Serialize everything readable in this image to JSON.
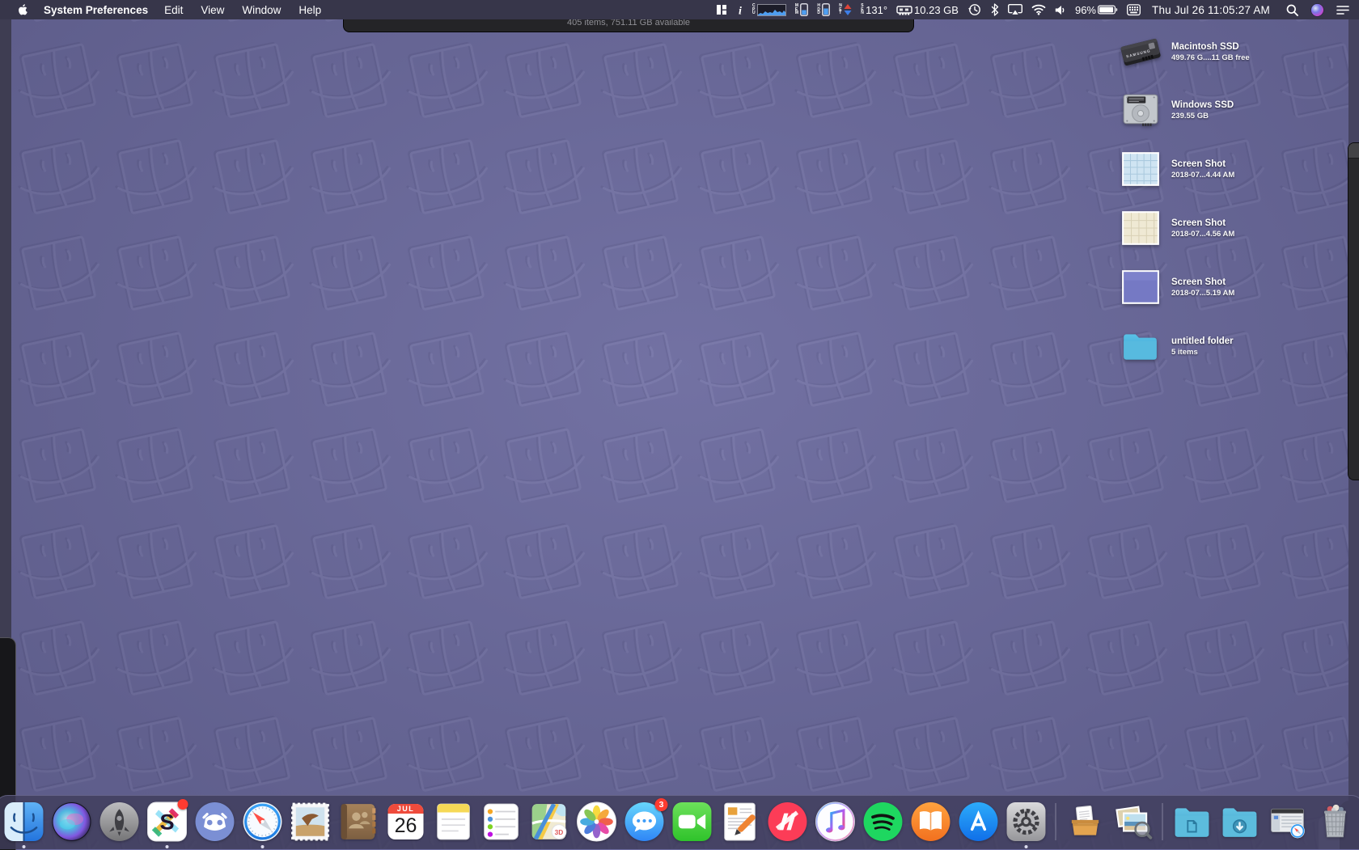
{
  "menu_bar": {
    "app_name": "System Preferences",
    "menus": [
      "Edit",
      "View",
      "Window",
      "Help"
    ],
    "status": {
      "istat_cpu_label": "CPU",
      "istat_mem_label": "MEM",
      "istat_hdd_label": "HDD",
      "istat_net_label": "NET",
      "istat_sen_label": "SEN",
      "sensor_temp": "131°",
      "memory_value": "10.23 GB",
      "battery_percent": "96%",
      "clock": "Thu Jul 26  11:05:27 AM"
    }
  },
  "finder_window": {
    "status_text": "405 items, 751.11 GB available"
  },
  "desktop": {
    "items": [
      {
        "id": "macintosh-ssd",
        "icon": "ssd",
        "name": "Macintosh SSD",
        "info": "499.76 G....11 GB free"
      },
      {
        "id": "windows-ssd",
        "icon": "hdd",
        "name": "Windows SSD",
        "info": "239.55 GB"
      },
      {
        "id": "screenshot-1",
        "icon": "shot_blue",
        "name": "Screen Shot",
        "info": "2018-07...4.44 AM"
      },
      {
        "id": "screenshot-2",
        "icon": "shot_cream",
        "name": "Screen Shot",
        "info": "2018-07...4.56 AM"
      },
      {
        "id": "screenshot-3",
        "icon": "shot_purple",
        "name": "Screen Shot",
        "info": "2018-07...5.19 AM"
      },
      {
        "id": "untitled-folder",
        "icon": "folder",
        "name": "untitled folder",
        "info": "5 items"
      }
    ]
  },
  "dock": {
    "items": [
      {
        "id": "finder",
        "label": "Finder",
        "running": true
      },
      {
        "id": "siri",
        "label": "Siri"
      },
      {
        "id": "launchpad",
        "label": "Launchpad"
      },
      {
        "id": "slack",
        "label": "Slack",
        "running": true,
        "badge_dot": true
      },
      {
        "id": "discord",
        "label": "Discord"
      },
      {
        "id": "safari",
        "label": "Safari",
        "running": true
      },
      {
        "id": "mail",
        "label": "Mail"
      },
      {
        "id": "contacts",
        "label": "Contacts"
      },
      {
        "id": "calendar",
        "label": "Calendar",
        "month": "JUL",
        "day": "26"
      },
      {
        "id": "notes",
        "label": "Notes"
      },
      {
        "id": "reminders",
        "label": "Reminders"
      },
      {
        "id": "maps",
        "label": "Maps"
      },
      {
        "id": "photos",
        "label": "Photos"
      },
      {
        "id": "messages",
        "label": "Messages",
        "badge": "3"
      },
      {
        "id": "facetime",
        "label": "FaceTime"
      },
      {
        "id": "pages",
        "label": "Pages"
      },
      {
        "id": "news",
        "label": "News"
      },
      {
        "id": "itunes",
        "label": "iTunes"
      },
      {
        "id": "spotify",
        "label": "Spotify"
      },
      {
        "id": "ibooks",
        "label": "iBooks"
      },
      {
        "id": "appstore",
        "label": "App Store"
      },
      {
        "id": "system-preferences",
        "label": "System Preferences",
        "running": true
      },
      {
        "type": "separator"
      },
      {
        "id": "unarchiver",
        "label": "Unarchiver"
      },
      {
        "id": "preview",
        "label": "Preview"
      },
      {
        "type": "separator"
      },
      {
        "id": "documents",
        "label": "Documents Folder"
      },
      {
        "id": "downloads",
        "label": "Downloads Folder"
      },
      {
        "id": "minimized-window",
        "label": "Minimized Safari Window"
      },
      {
        "id": "trash",
        "label": "Trash"
      }
    ]
  },
  "colors": {
    "wallpaper": "#6b6a9e",
    "menubar": "#37364a",
    "dock_background": "rgba(63,61,92,0.82)",
    "badge": "#ff3b30",
    "folder_blue": "#57badf"
  }
}
